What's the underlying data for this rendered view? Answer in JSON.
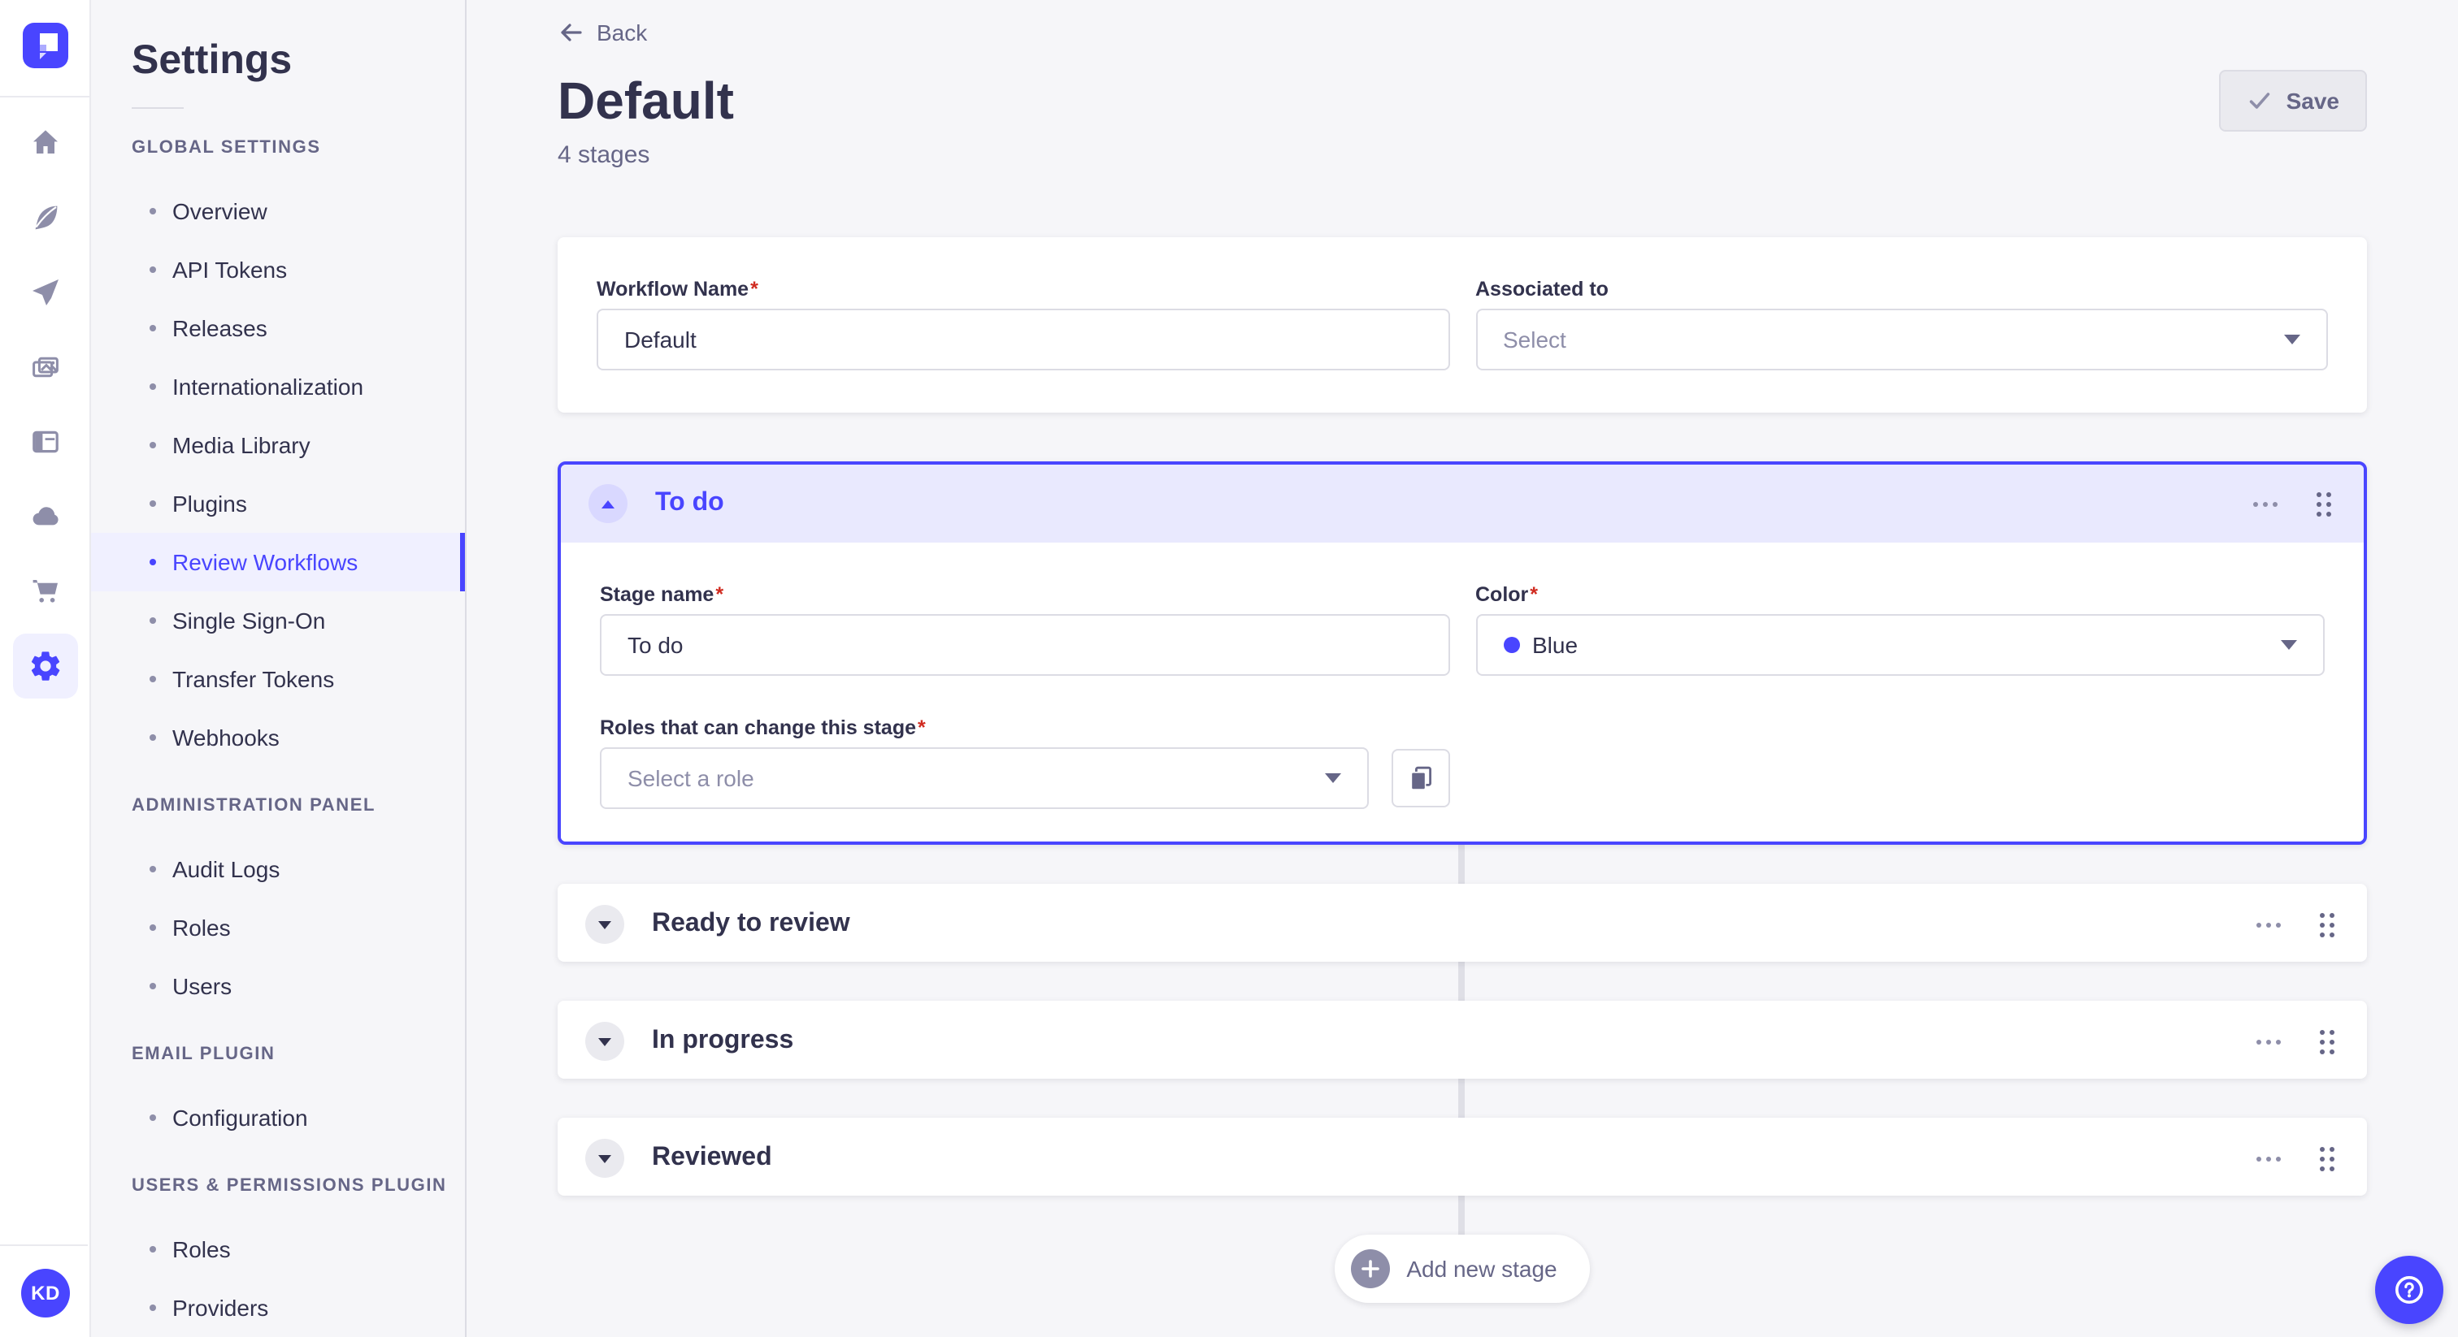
{
  "colors": {
    "primary": "#4945FF",
    "primary_light": "#F0F0FF",
    "stage_header_bg": "#E9E9FE",
    "text": "#32324D",
    "muted": "#666687",
    "icon_gray": "#8E8EA9",
    "border": "#DCDCE4",
    "page_bg": "#F6F6F9",
    "required": "#D02B20",
    "stage_color_value": "#4945FF"
  },
  "ui": {
    "required_marker": "*"
  },
  "rail": {
    "logo_icon": "strapi-logo",
    "icons": [
      "home-icon",
      "feather-icon",
      "send-icon",
      "media-icon",
      "layout-icon",
      "cloud-icon",
      "cart-icon",
      "gear-icon"
    ],
    "active_icon": "gear-icon",
    "avatar_initials": "KD"
  },
  "settings_nav": {
    "title": "Settings",
    "sections": [
      {
        "label": "GLOBAL SETTINGS",
        "items": [
          {
            "label": "Overview"
          },
          {
            "label": "API Tokens"
          },
          {
            "label": "Releases"
          },
          {
            "label": "Internationalization"
          },
          {
            "label": "Media Library"
          },
          {
            "label": "Plugins"
          },
          {
            "label": "Review Workflows",
            "active": true
          },
          {
            "label": "Single Sign-On"
          },
          {
            "label": "Transfer Tokens"
          },
          {
            "label": "Webhooks"
          }
        ]
      },
      {
        "label": "ADMINISTRATION PANEL",
        "items": [
          {
            "label": "Audit Logs"
          },
          {
            "label": "Roles"
          },
          {
            "label": "Users"
          }
        ]
      },
      {
        "label": "EMAIL PLUGIN",
        "items": [
          {
            "label": "Configuration"
          }
        ]
      },
      {
        "label": "USERS & PERMISSIONS PLUGIN",
        "items": [
          {
            "label": "Roles"
          },
          {
            "label": "Providers"
          }
        ]
      }
    ]
  },
  "header": {
    "back_label": "Back",
    "title": "Default",
    "subtitle": "4 stages",
    "save_label": "Save"
  },
  "workflow_form": {
    "name_label": "Workflow Name",
    "name_value": "Default",
    "associated_label": "Associated to",
    "associated_placeholder": "Select"
  },
  "stages": [
    {
      "name": "To do",
      "expanded": true,
      "fields": {
        "stage_name_label": "Stage name",
        "stage_name_value": "To do",
        "color_label": "Color",
        "color_value": "Blue",
        "roles_label": "Roles that can change this stage",
        "roles_placeholder": "Select a role"
      }
    },
    {
      "name": "Ready to review"
    },
    {
      "name": "In progress"
    },
    {
      "name": "Reviewed"
    }
  ],
  "add_stage_label": "Add new stage"
}
